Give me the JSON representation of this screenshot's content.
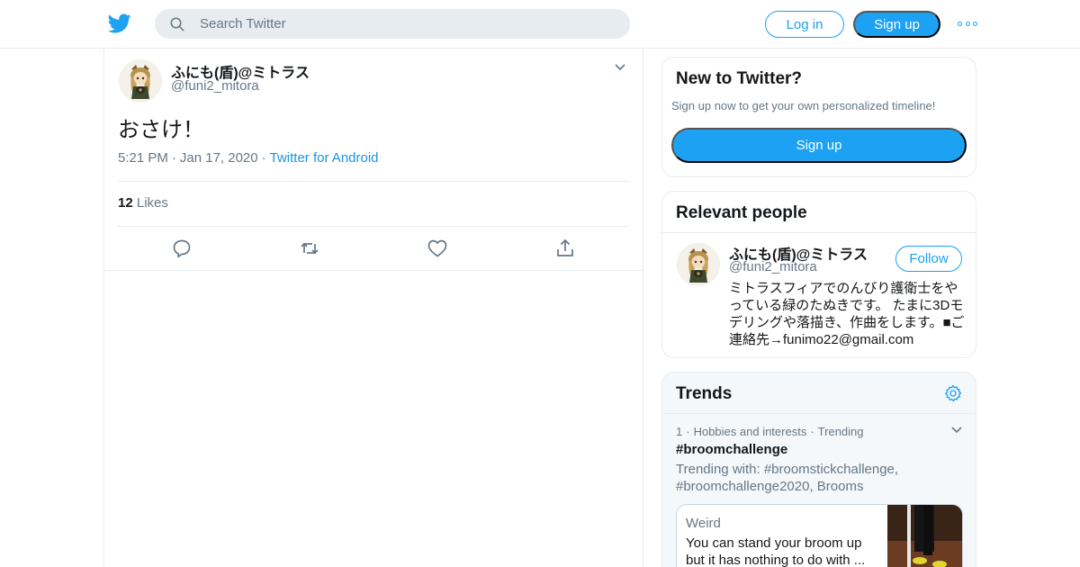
{
  "header": {
    "search_placeholder": "Search Twitter",
    "login_label": "Log in",
    "signup_label": "Sign up"
  },
  "tweet": {
    "display_name": "ふにも(盾)@ミトラス",
    "handle": "@funi2_mitora",
    "text": "おさけ！",
    "time": "5:21 PM",
    "date": "Jan 17, 2020",
    "source": "Twitter for Android",
    "likes_count": "12",
    "likes_label": "Likes",
    "sep": "·"
  },
  "sidebar": {
    "new_card": {
      "title": "New to Twitter?",
      "subtext": "Sign up now to get your own personalized timeline!",
      "button": "Sign up"
    },
    "people_card": {
      "title": "Relevant people",
      "display_name": "ふにも(盾)@ミトラス",
      "handle": "@funi2_mitora",
      "follow": "Follow",
      "bio": "ミトラスフィアでのんびり護衛士をやっている緑のたぬきです。 たまに3Dモデリングや落描き、作曲をします。■ご連絡先→funimo22@gmail.com"
    },
    "trends_card": {
      "title": "Trends",
      "rank": "1",
      "category": "Hobbies and interests",
      "status": "Trending",
      "name": "#broomchallenge",
      "trending_with": "Trending with: #broomstickchallenge, #broomchallenge2020, Brooms",
      "moment_category": "Weird",
      "moment_text": "You can stand your broom up but it has nothing to do with ..."
    }
  },
  "colors": {
    "brand": "#1da1f2",
    "link": "#1b95e0",
    "secondary_text": "#657786",
    "border": "#e6ecf0"
  },
  "icons": [
    "twitter-bird-icon",
    "search-icon",
    "more-icon",
    "chevron-down-icon",
    "reply-icon",
    "retweet-icon",
    "like-icon",
    "share-icon",
    "gear-icon"
  ]
}
